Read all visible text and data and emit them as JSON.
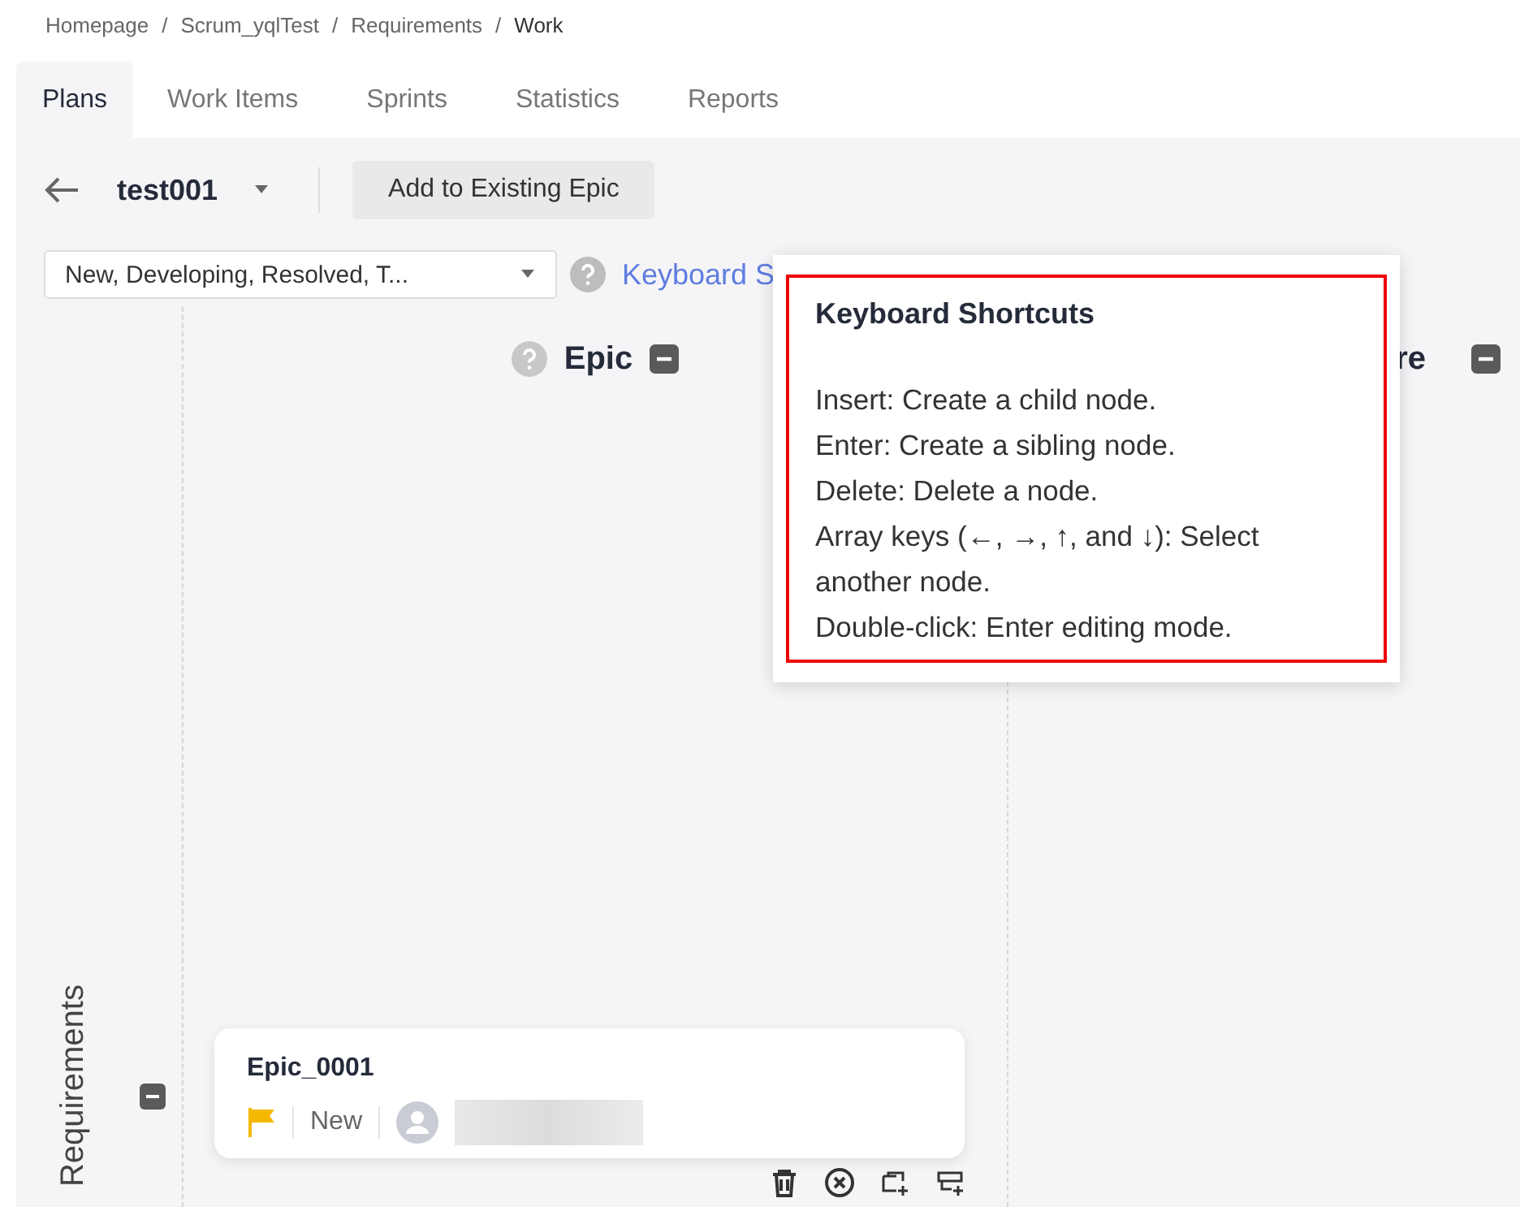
{
  "breadcrumb": [
    {
      "label": "Homepage",
      "current": false
    },
    {
      "label": "Scrum_yqlTest",
      "current": false
    },
    {
      "label": "Requirements",
      "current": false
    },
    {
      "label": "Work",
      "current": true
    }
  ],
  "breadcrumb_separators": [
    "/",
    "/",
    "/"
  ],
  "tabs": [
    {
      "label": "Plans",
      "selected": true
    },
    {
      "label": "Work Items",
      "selected": false
    },
    {
      "label": "Sprints",
      "selected": false
    },
    {
      "label": "Statistics",
      "selected": false
    },
    {
      "label": "Reports",
      "selected": false
    }
  ],
  "toolbar": {
    "title": "test001",
    "button": "Add to Existing Epic"
  },
  "filter": {
    "value": "New, Developing, Resolved, T..."
  },
  "help_link": "Keyboard S",
  "columns": [
    {
      "title": "Epic",
      "help": true
    },
    {
      "title": "re",
      "help": false
    }
  ],
  "lane": "Requirements",
  "card": {
    "title": "Epic_0001",
    "status": "New"
  },
  "popover": {
    "title": "Keyboard Shortcuts",
    "lines": [
      "Insert: Create a child node.",
      "Enter: Create a sibling node.",
      "Delete: Delete a node.",
      "Array keys (←, →, ↑, and ↓): Select another node.",
      "Double-click: Enter editing mode."
    ]
  }
}
